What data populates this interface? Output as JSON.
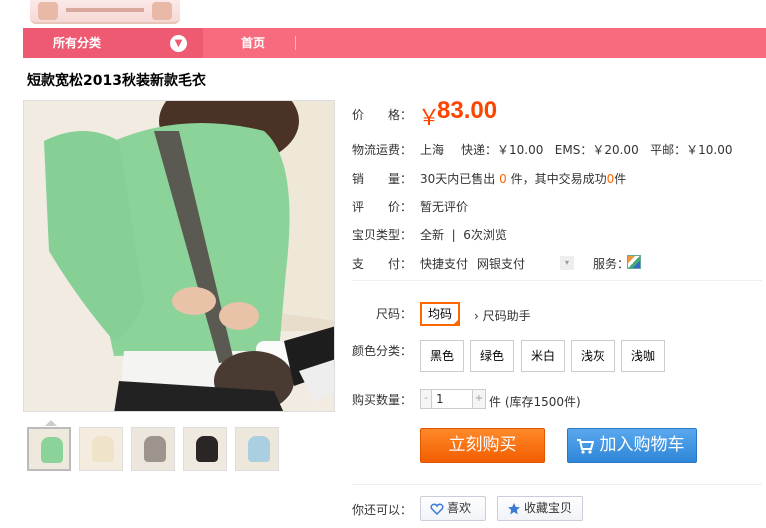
{
  "nav": {
    "category_label": "所有分类",
    "home_label": "首页"
  },
  "product": {
    "title": "短款宽松2013秋装新款毛衣"
  },
  "details": {
    "price_label": "价　　格：",
    "currency": "￥",
    "price": "83.00",
    "shipping_label": "物流运费：",
    "shipping_from": "上海",
    "shipping_rates": "快递：￥10.00   EMS：￥20.00   平邮：￥10.00",
    "sales_label": "销　　量：",
    "sales_prefix": "30天内已售出",
    "sales_count": "0",
    "sales_mid": "件，其中交易成功",
    "sales_success": "0",
    "sales_suffix": "件",
    "review_label": "评　　价：",
    "review_value": "暂无评价",
    "type_label": "宝贝类型：",
    "type_value": "全新  |  6次浏览",
    "pay_label": "支　　付：",
    "pay_fast": "快捷支付",
    "pay_bank": "网银支付",
    "service_label": "服务："
  },
  "options": {
    "size_label": "尺码：",
    "size_value": "均码",
    "size_help": "尺码助手",
    "color_label": "颜色分类：",
    "colors": [
      "黑色",
      "绿色",
      "米白",
      "浅灰",
      "浅咖"
    ],
    "qty_label": "购买数量：",
    "qty_minus": "-",
    "qty_value": "1",
    "qty_plus": "+",
    "stock": "件 (库存1500件)"
  },
  "actions": {
    "buy_now": "立刻购买",
    "add_to_cart": "加入购物车",
    "more_label": "你还可以：",
    "like": "喜欢",
    "favorite": "收藏宝贝"
  },
  "colors": {
    "accent": "#f86b7e",
    "price": "#ff4400",
    "buy": "#f25d00",
    "cart": "#2e86d8"
  }
}
